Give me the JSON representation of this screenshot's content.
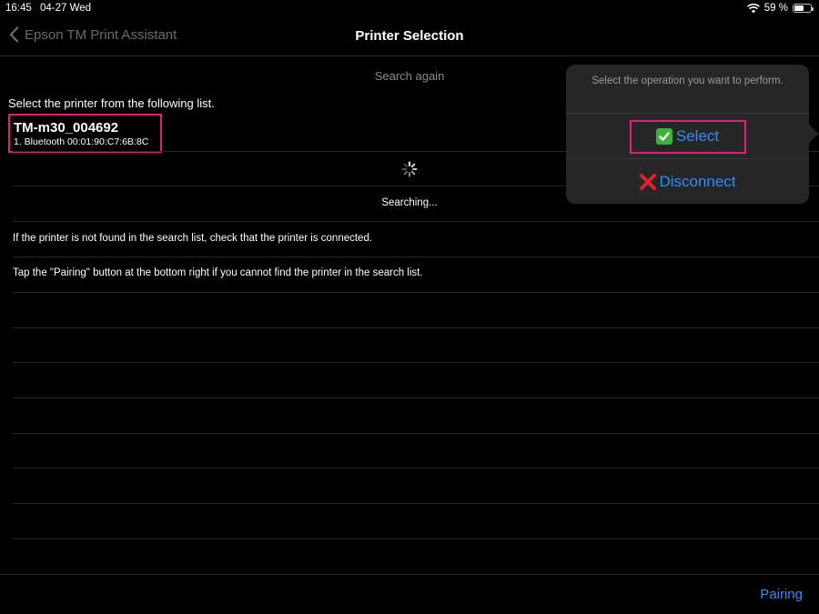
{
  "status_bar": {
    "time": "16:45",
    "date": "04-27 Wed",
    "battery_text": "59 %",
    "battery_level": 0.59
  },
  "nav": {
    "back_label": "Epson TM Print Assistant",
    "title": "Printer Selection"
  },
  "search_again_label": "Search again",
  "instruction": "Select the printer from the following list.",
  "printers": [
    {
      "name": "TM-m30_004692",
      "detail": "1. Bluetooth 00:01:90:C7:6B:8C"
    }
  ],
  "searching_text": "Searching...",
  "hints": [
    "If the printer is not found in the search list, check that the printer is connected.",
    "Tap the \"Pairing\" button at the bottom right if you cannot find the printer in the search list."
  ],
  "pairing_label": "Pairing",
  "popover": {
    "message": "Select the operation you want to perform.",
    "select_label": "Select",
    "disconnect_label": "Disconnect"
  },
  "colors": {
    "accent": "#2f8cff",
    "highlight": "#e0207a",
    "check": "#3cb43c",
    "cross": "#e0212e"
  },
  "icons": [
    "wifi-icon",
    "battery-icon",
    "chevron-left-icon",
    "spinner-icon",
    "check-icon",
    "cross-icon"
  ]
}
